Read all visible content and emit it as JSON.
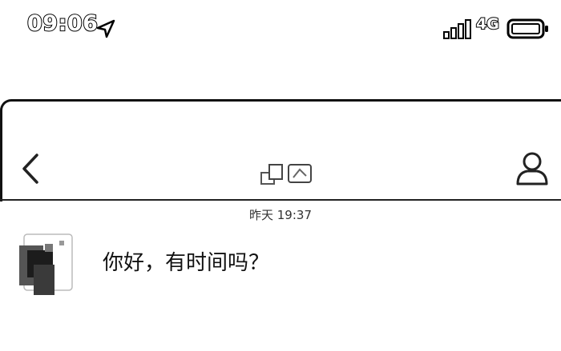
{
  "status_bar": {
    "time": "09:06",
    "network": "4G",
    "icons": [
      "location-arrow-icon",
      "cellular-signal-icon",
      "battery-icon"
    ]
  },
  "nav_bar": {
    "back_icon": "chevron-left-icon",
    "title_icon": "contact-name-image",
    "right_icon": "contact-profile-icon"
  },
  "chat": {
    "timestamp": "昨天 19:37",
    "messages": [
      {
        "sender": "contact",
        "text": "你好，有时间吗？"
      }
    ]
  }
}
